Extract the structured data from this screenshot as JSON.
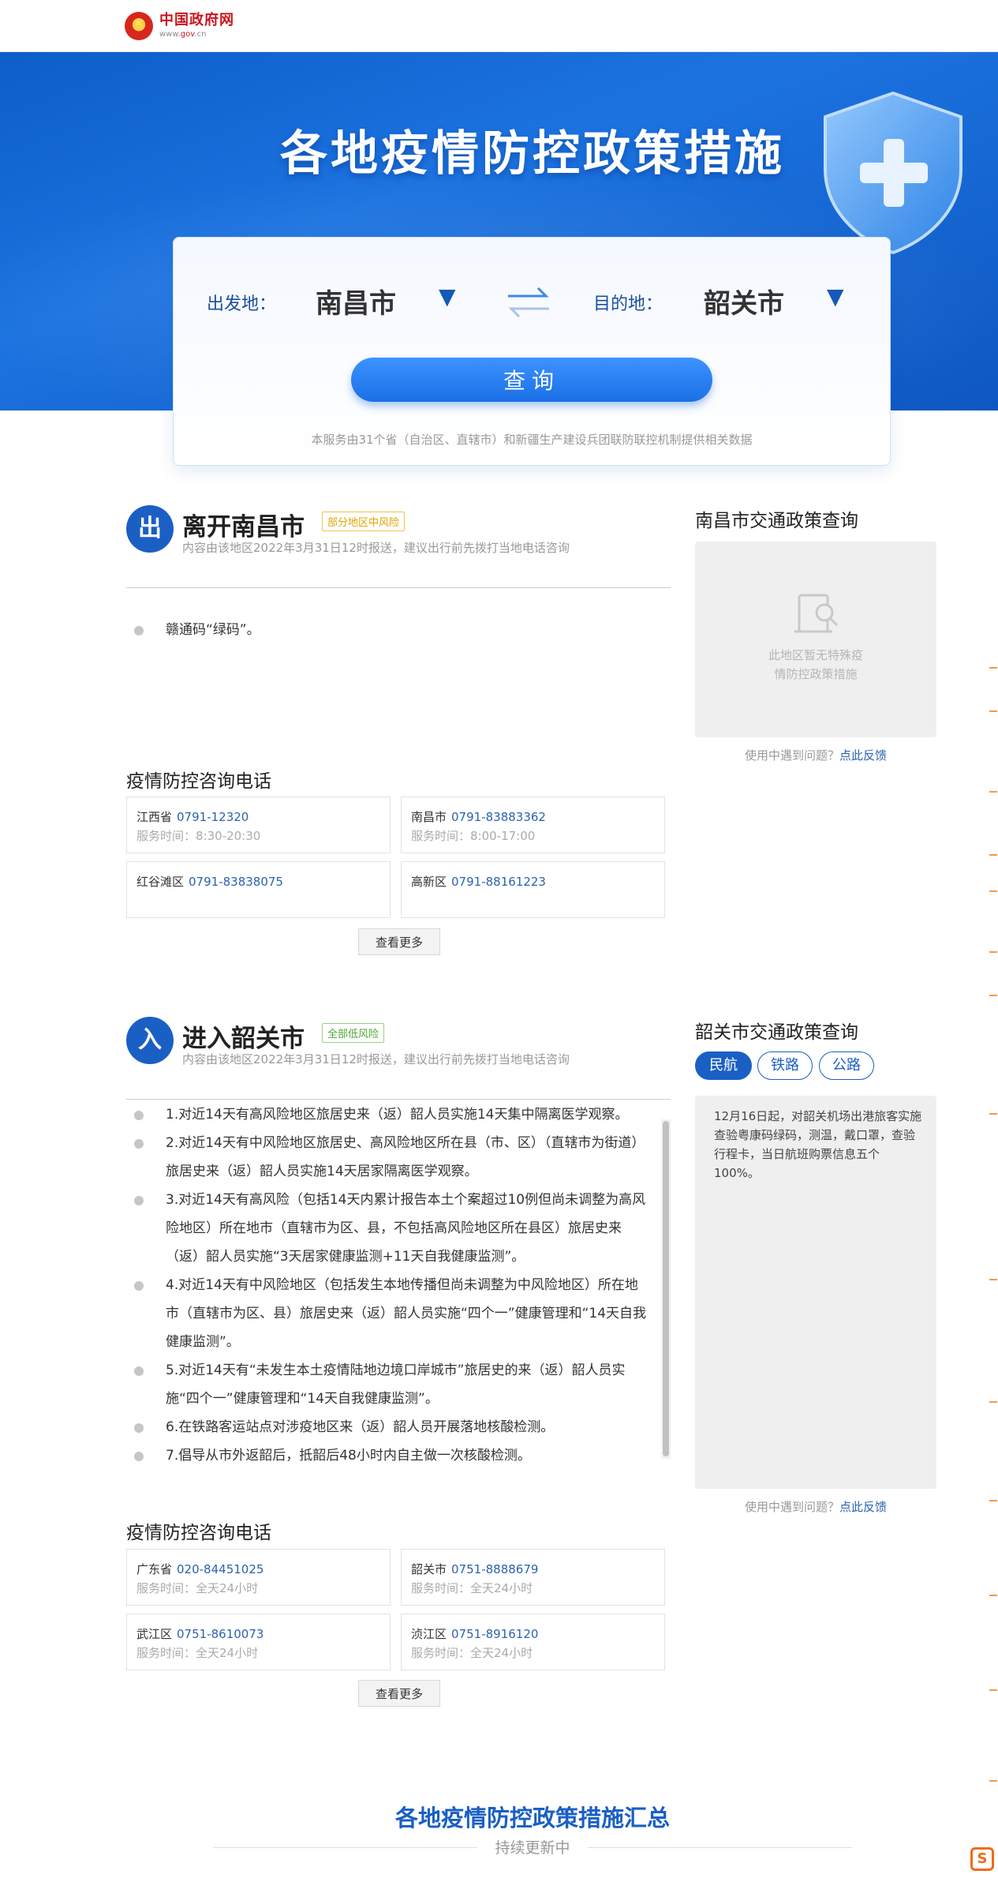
{
  "header": {
    "site_name": "中国政府网",
    "site_url_prefix": "www.",
    "site_url_brand": "gov",
    "site_url_suffix": ".cn"
  },
  "banner": {
    "title": "各地疫情防控政策措施"
  },
  "search": {
    "from_label": "出发地：",
    "from_city": "南昌市",
    "to_label": "目的地：",
    "to_city": "韶关市",
    "query_button": "查询",
    "note": "本服务由31个省（自治区、直辖市）和新疆生产建设兵团联防联控机制提供相关数据"
  },
  "leave": {
    "badge": "出",
    "title": "离开南昌市",
    "risk_tag": "部分地区中风险",
    "subtitle": "内容由该地区2022年3月31日12时报送，建议出行前先拨打当地电话咨询",
    "policies": [
      "赣通码“绿码”。"
    ],
    "phone_title": "疫情防控咨询电话",
    "phones": [
      {
        "area": "江西省",
        "number": "0791-12320",
        "hours": "服务时间：8:30-20:30"
      },
      {
        "area": "南昌市",
        "number": "0791-83883362",
        "hours": "服务时间：8:00-17:00"
      },
      {
        "area": "红谷滩区",
        "number": "0791-83838075",
        "hours": ""
      },
      {
        "area": "高新区",
        "number": "0791-88161223",
        "hours": ""
      }
    ],
    "more_button": "查看更多",
    "side_title": "南昌市交通政策查询",
    "side_empty_line1": "此地区暂无特殊疫",
    "side_empty_line2": "情防控政策措施",
    "feedback_text": "使用中遇到问题？",
    "feedback_link": "点此反馈"
  },
  "enter": {
    "badge": "入",
    "title": "进入韶关市",
    "risk_tag": "全部低风险",
    "subtitle": "内容由该地区2022年3月31日12时报送，建议出行前先拨打当地电话咨询",
    "policies": [
      "1.对近14天有高风险地区旅居史来（返）韶人员实施14天集中隔离医学观察。",
      "2.对近14天有中风险地区旅居史、高风险地区所在县（市、区）（直辖市为街道）旅居史来（返）韶人员实施14天居家隔离医学观察。",
      "3.对近14天有高风险（包括14天内累计报告本土个案超过10例但尚未调整为高风险地区）所在地市（直辖市为区、县，不包括高风险地区所在县区）旅居史来（返）韶人员实施“3天居家健康监测+11天自我健康监测”。",
      "4.对近14天有中风险地区（包括发生本地传播但尚未调整为中风险地区）所在地市（直辖市为区、县）旅居史来（返）韶人员实施“四个一”健康管理和“14天自我健康监测”。",
      "5.对近14天有“未发生本土疫情陆地边境口岸城市”旅居史的来（返）韶人员实施“四个一”健康管理和“14天自我健康监测”。",
      "6.在铁路客运站点对涉疫地区来（返）韶人员开展落地核酸检测。",
      "7.倡导从市外返韶后，抵韶后48小时内自主做一次核酸检测。"
    ],
    "phone_title": "疫情防控咨询电话",
    "phones": [
      {
        "area": "广东省",
        "number": "020-84451025",
        "hours": "服务时间：全天24小时"
      },
      {
        "area": "韶关市",
        "number": "0751-8888679",
        "hours": "服务时间：全天24小时"
      },
      {
        "area": "武江区",
        "number": "0751-8610073",
        "hours": "服务时间：全天24小时"
      },
      {
        "area": "浈江区",
        "number": "0751-8916120",
        "hours": "服务时间：全天24小时"
      }
    ],
    "more_button": "查看更多",
    "side_title": "韶关市交通政策查询",
    "tabs": [
      "民航",
      "铁路",
      "公路"
    ],
    "side_text": "12月16日起，对韶关机场出港旅客实施查验粤康码绿码，测温，戴口罩，查验行程卡，当日航班购票信息五个100%。",
    "feedback_text": "使用中遇到问题？",
    "feedback_link": "点此反馈"
  },
  "summary": {
    "title": "各地疫情防控政策措施汇总",
    "subtitle": "持续更新中"
  },
  "colors": {
    "brand_blue": "#1a5fc4",
    "gov_red": "#c8161d",
    "link_blue": "#2b62b0"
  }
}
